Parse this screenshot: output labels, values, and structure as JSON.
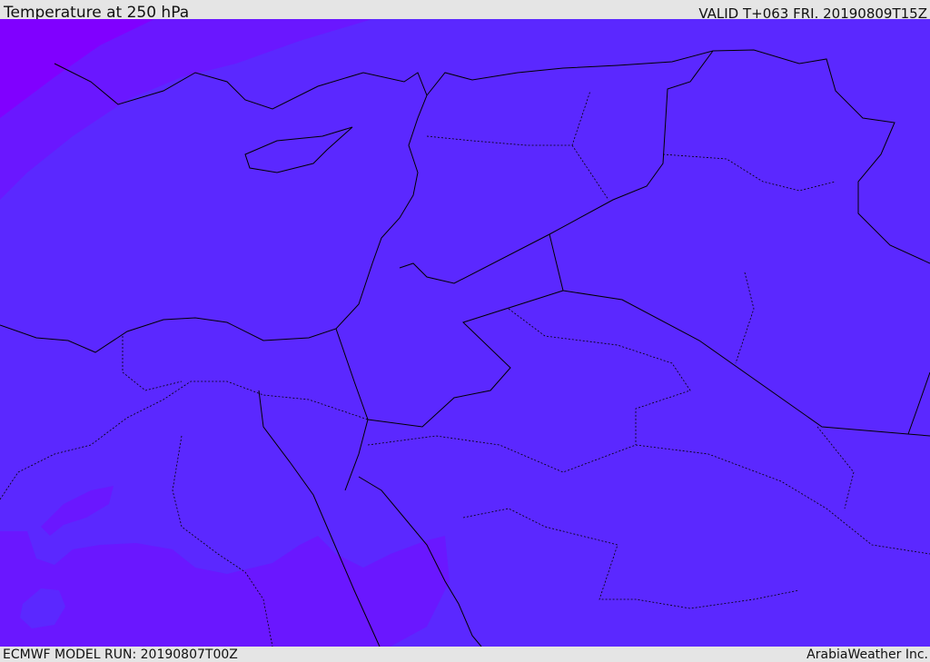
{
  "header": {
    "title": "Temperature at 250 hPa",
    "valid": "VALID T+063 FRI. 20190809T15Z"
  },
  "footer": {
    "model_run": "ECMWF MODEL RUN: 20190807T00Z",
    "credit": "ArabiaWeather Inc."
  },
  "colors": {
    "base": "#5b28ff",
    "warmer_band": "#6a17ff",
    "warmest_corner": "#8000ff",
    "borders": "#000000",
    "background": "#e5e5e5"
  }
}
